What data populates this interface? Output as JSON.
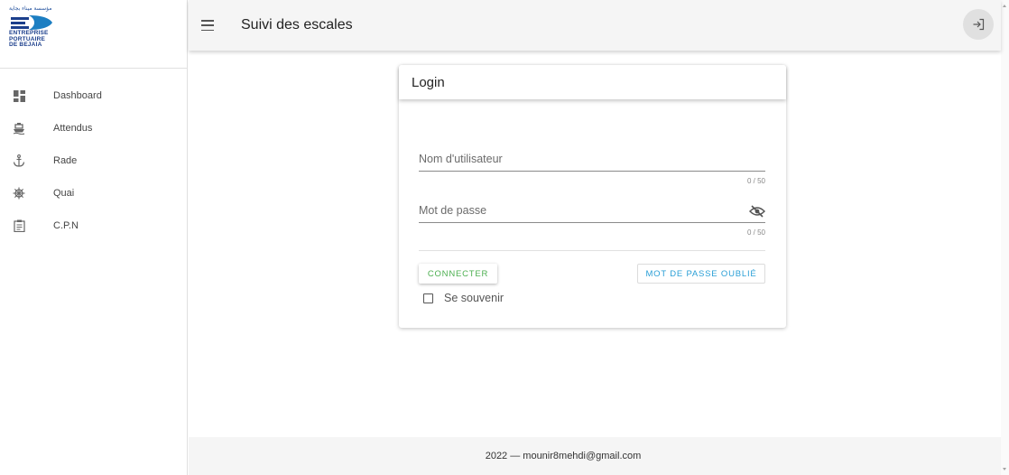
{
  "sidebar": {
    "logo": {
      "arabic_text": "مؤسسة ميناء بجاية",
      "lines": [
        "ENTREPRISE",
        "PORTUAIRE",
        "DE BEJAIA"
      ],
      "brand_color": "#1c3f8c"
    },
    "items": [
      {
        "label": "Dashboard",
        "icon": "dashboard-icon"
      },
      {
        "label": "Attendus",
        "icon": "ship-icon"
      },
      {
        "label": "Rade",
        "icon": "anchor-icon"
      },
      {
        "label": "Quai",
        "icon": "ship-wheel-icon"
      },
      {
        "label": "C.P.N",
        "icon": "clipboard-icon"
      }
    ]
  },
  "header": {
    "title": "Suivi des escales",
    "menu_icon": "hamburger-icon",
    "logout_icon": "logout-icon"
  },
  "login": {
    "title": "Login",
    "username": {
      "placeholder": "Nom d'utilisateur",
      "value": "",
      "counter": "0 / 50"
    },
    "password": {
      "placeholder": "Mot de passe",
      "value": "",
      "counter": "0 / 50",
      "icon": "eye-off-icon"
    },
    "connect_label": "CONNECTER",
    "forgot_label": "MOT DE PASSE OUBLIÉ",
    "remember_label": "Se souvenir",
    "remember_checked": false
  },
  "footer": {
    "text": "2022 — mounir8mehdi@gmail.com"
  },
  "colors": {
    "accent_green": "#4caf50",
    "accent_blue": "#2a9fd6",
    "header_bg": "#f5f5f5"
  }
}
